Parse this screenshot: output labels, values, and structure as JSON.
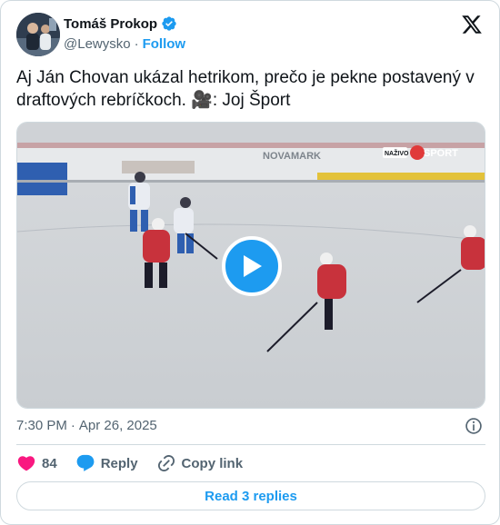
{
  "author": {
    "display_name": "Tomáš Prokop",
    "handle": "@Lewysko",
    "separator": "·",
    "follow_label": "Follow"
  },
  "tweet": {
    "text": "Aj Ján Chovan ukázal hetrikom, prečo je pekne postavený v draftových rebríčkoch. 🎥: Joj Šport",
    "time": "7:30 PM",
    "date_separator": "·",
    "date": "Apr 26, 2025"
  },
  "video": {
    "overlay_live": "NAŽIVO",
    "overlay_channel": "SPORT",
    "board_text": "NOVAMARK"
  },
  "actions": {
    "like_count": "84",
    "reply_label": "Reply",
    "copy_label": "Copy link"
  },
  "read_replies_label": "Read 3 replies",
  "colors": {
    "accent": "#1d9bf0",
    "like": "#f91880",
    "text_secondary": "#536471",
    "border": "#cfd9de"
  },
  "icons": {
    "verified": "verified-badge-icon",
    "x_logo": "x-logo-icon",
    "info": "info-icon",
    "heart": "heart-icon",
    "reply": "reply-bubble-icon",
    "copy": "link-icon",
    "play": "play-icon"
  }
}
